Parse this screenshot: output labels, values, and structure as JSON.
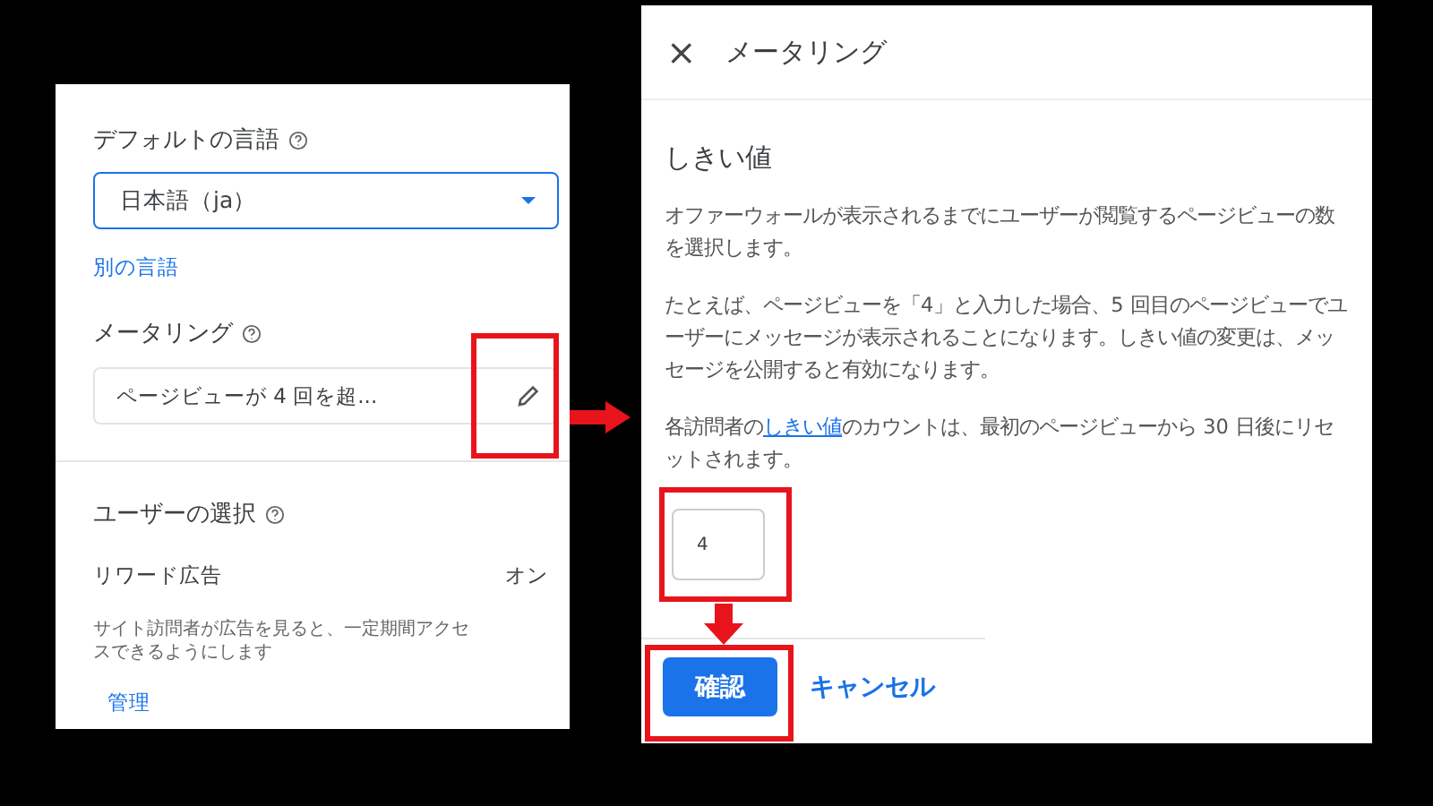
{
  "settings_panel": {
    "language": {
      "heading": "デフォルトの言語",
      "value": "日本語（ja）",
      "link": "別の言語"
    },
    "metering": {
      "heading": "メータリング",
      "summary": "ページビューが 4 回を超..."
    },
    "user_choice": {
      "heading": "ユーザーの選択",
      "option": "リワード広告",
      "status": "オン",
      "description": "サイト訪問者が広告を見ると、一定期間アクセスできるようにします",
      "link": "管理"
    }
  },
  "metering_dialog": {
    "close": "×",
    "title": "メータリング",
    "heading": "しきい値",
    "paragraphs": [
      {
        "before": "オファーウォールが表示されるまでにユーザーが閲覧するページビューの数を選択します。"
      },
      {
        "before": "たとえば、ページビューを「4」と入力した場合、5 回目のページビューでユーザーにメッセージが表示されることになります。しきい値の変更は、メッセージを公開すると有効になります。"
      },
      {
        "before": "各訪問者の",
        "link": "しきい値",
        "after": "のカウントは、最初のページビューから 30 日後にリセットされます。"
      }
    ],
    "threshold_value": "4",
    "buttons": [
      {
        "label": "確認",
        "kind": "primary"
      },
      {
        "label": "キャンセル",
        "kind": "text"
      }
    ]
  }
}
